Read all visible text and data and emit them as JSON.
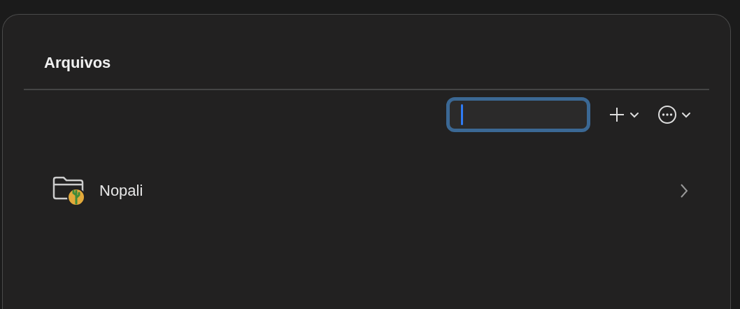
{
  "window": {
    "title": "Arquivos"
  },
  "search": {
    "focused": true
  },
  "toolbar": [
    {
      "kind": "add"
    },
    {
      "kind": "more"
    }
  ],
  "items": [
    {
      "name": "Nopali",
      "kind": "folder"
    }
  ]
}
